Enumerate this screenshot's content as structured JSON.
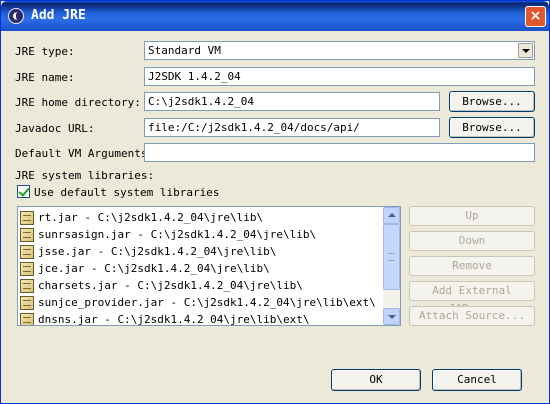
{
  "window": {
    "title": "Add JRE",
    "close_glyph": "×"
  },
  "form": {
    "jre_type_label": "JRE type:",
    "jre_type_value": "Standard VM",
    "jre_name_label": "JRE name:",
    "jre_name_value": "J2SDK 1.4.2_04",
    "home_dir_label": "JRE home directory:",
    "home_dir_value": "C:\\j2sdk1.4.2_04",
    "javadoc_label": "Javadoc URL:",
    "javadoc_value": "file:/C:/j2sdk1.4.2_04/docs/api/",
    "vm_args_label": "Default VM Arguments:",
    "vm_args_value": "",
    "browse_label": "Browse..."
  },
  "libraries": {
    "section_label": "JRE system libraries:",
    "use_default_label": "Use default system libraries",
    "use_default_checked": true,
    "items": [
      {
        "label": "rt.jar - C:\\j2sdk1.4.2_04\\jre\\lib\\"
      },
      {
        "label": "sunrsasign.jar - C:\\j2sdk1.4.2_04\\jre\\lib\\"
      },
      {
        "label": "jsse.jar - C:\\j2sdk1.4.2_04\\jre\\lib\\"
      },
      {
        "label": "jce.jar - C:\\j2sdk1.4.2_04\\jre\\lib\\"
      },
      {
        "label": "charsets.jar - C:\\j2sdk1.4.2_04\\jre\\lib\\"
      },
      {
        "label": "sunjce_provider.jar - C:\\j2sdk1.4.2_04\\jre\\lib\\ext\\"
      },
      {
        "label": "dnsns.jar - C:\\j2sdk1.4.2_04\\jre\\lib\\ext\\"
      }
    ],
    "buttons": {
      "up": "Up",
      "down": "Down",
      "remove": "Remove",
      "add_external": "Add External JARs...",
      "attach_source": "Attach Source..."
    }
  },
  "footer": {
    "ok": "OK",
    "cancel": "Cancel"
  }
}
